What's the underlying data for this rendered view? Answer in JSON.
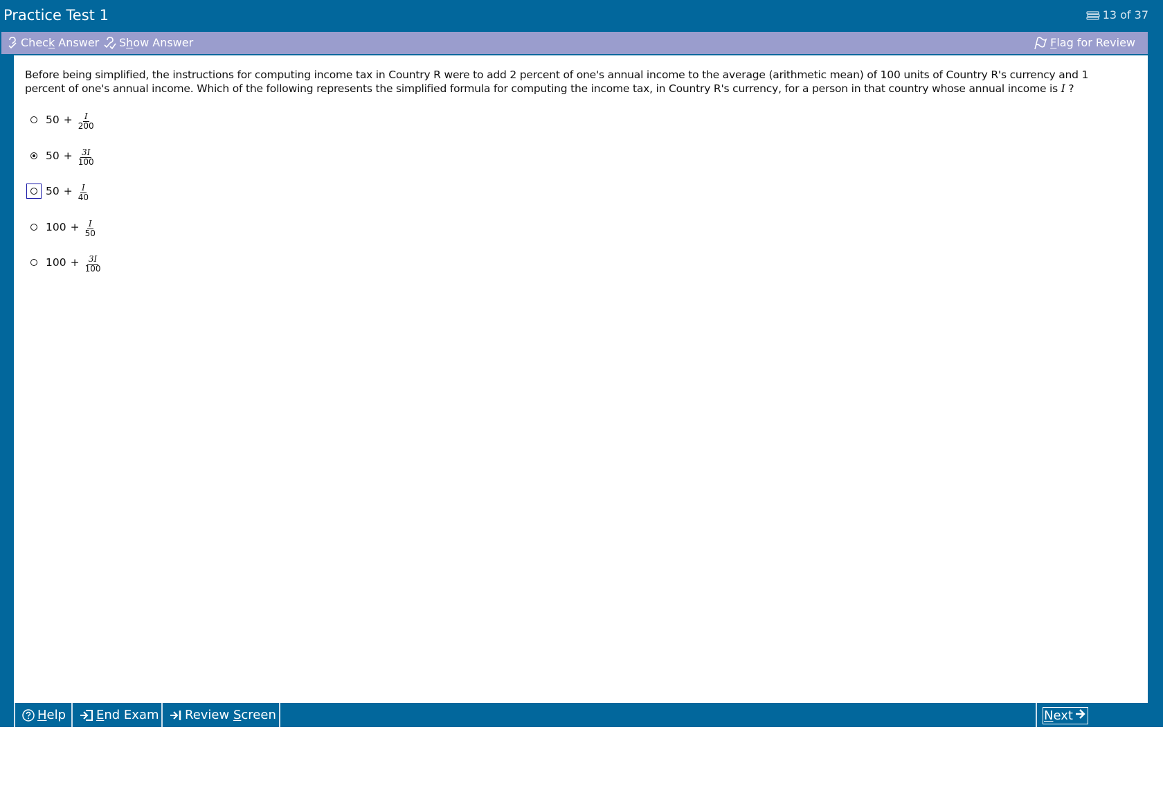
{
  "app": {
    "title": "Practice Test 1",
    "progress": "13 of 37"
  },
  "toolbar": {
    "check_answer": {
      "pre": "Chec",
      "key": "k",
      "post": " Answer"
    },
    "show_answer": {
      "pre": "S",
      "key": "h",
      "post": "ow Answer"
    },
    "flag_review": {
      "pre": "",
      "key": "F",
      "post": "lag for Review"
    }
  },
  "question": {
    "text_before": "Before being simplified, the instructions for computing income tax in Country R were to add 2 percent of one's annual income to the average (arithmetic mean) of 100 units of Country R's currency and 1 percent of one's annual income.  Which of the following represents the simplified formula for computing the income tax, in Country R's currency, for a person in that country whose annual income is ",
    "variable": "I",
    "text_after": " ?"
  },
  "choices": [
    {
      "whole": "50",
      "plus": "+",
      "numerator": "I",
      "denominator": "200",
      "selected": false,
      "focused": false
    },
    {
      "whole": "50",
      "plus": "+",
      "numerator": "3I",
      "denominator": "100",
      "selected": true,
      "focused": false
    },
    {
      "whole": "50",
      "plus": "+",
      "numerator": "I",
      "denominator": "40",
      "selected": false,
      "focused": true
    },
    {
      "whole": "100",
      "plus": "+",
      "numerator": "I",
      "denominator": "50",
      "selected": false,
      "focused": false
    },
    {
      "whole": "100",
      "plus": "+",
      "numerator": "3I",
      "denominator": "100",
      "selected": false,
      "focused": false
    }
  ],
  "bottom": {
    "help": {
      "pre": "",
      "key": "H",
      "post": "elp"
    },
    "end_exam": {
      "pre": "",
      "key": "E",
      "post": "nd Exam"
    },
    "review_screen": {
      "pre": "Review ",
      "key": "S",
      "post": "creen"
    },
    "next": {
      "pre": "",
      "key": "N",
      "post": "ext"
    }
  },
  "colors": {
    "primary_blue": "#02679c",
    "toolbar_lavender": "#9a9dcd",
    "focus_border": "#1a1aa8"
  },
  "icons": {
    "progress": "stack-icon",
    "check_answer": "check-answer-icon",
    "show_answer": "show-answer-icon",
    "flag": "flag-icon",
    "help": "question-circle-icon",
    "end_exam": "exit-arrow-icon",
    "review": "arrow-to-bar-icon",
    "next": "right-arrow-icon"
  }
}
